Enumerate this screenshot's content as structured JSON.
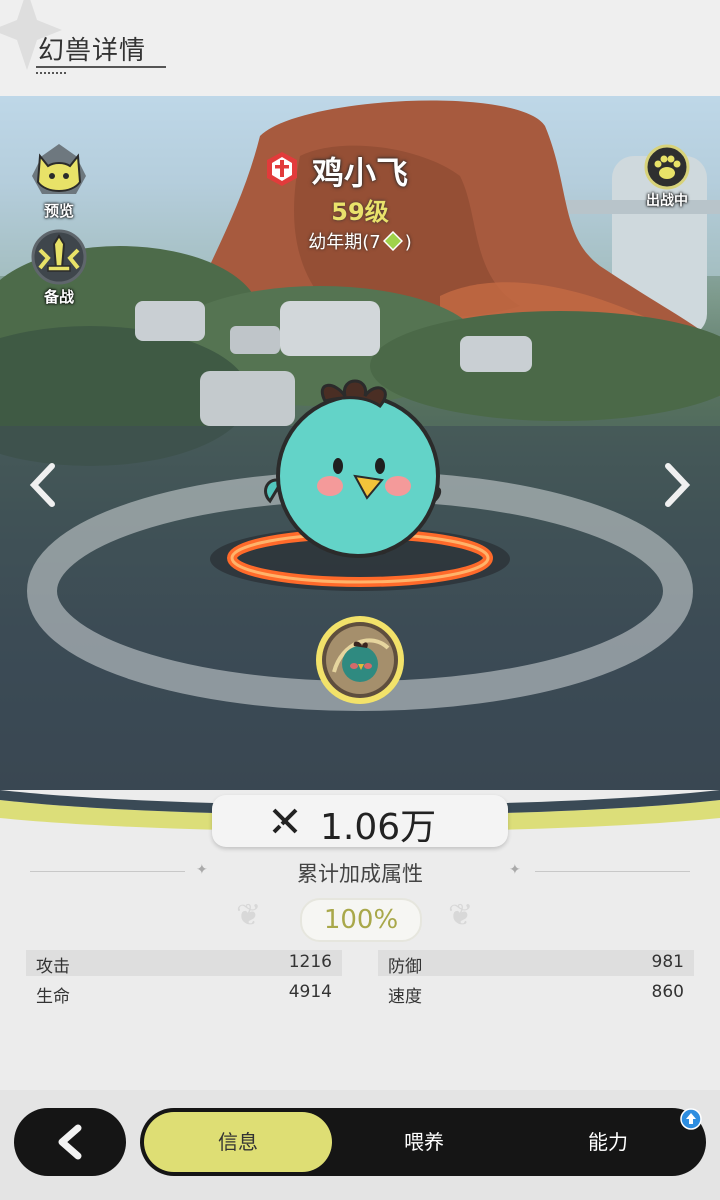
{
  "header": {
    "title": "幻兽详情"
  },
  "side_buttons": {
    "preview": "预览",
    "prepare": "备战",
    "deployed": "出战中"
  },
  "pet": {
    "name": "鸡小飞",
    "level": "59级",
    "stage_prefix": "幼年期(7",
    "stage_suffix": ")"
  },
  "power": {
    "value": "1.06万"
  },
  "bonus": {
    "label": "累计加成属性",
    "value": "100%"
  },
  "stats": [
    {
      "name": "攻击",
      "value": "1216"
    },
    {
      "name": "防御",
      "value": "981"
    },
    {
      "name": "生命",
      "value": "4914"
    },
    {
      "name": "速度",
      "value": "860"
    }
  ],
  "tabs": {
    "info": "信息",
    "feed": "喂养",
    "ability": "能力"
  },
  "colors": {
    "accent": "#dede74",
    "nav_dark": "#151515",
    "level_yellow": "#e9e26b",
    "ring_orange": "#ff6a2a"
  },
  "icons": {
    "preview": "cat-icon",
    "prepare": "sword-shield-icon",
    "deployed": "paw-icon",
    "element": "sword-emblem-icon",
    "power": "crossed-swords-icon",
    "back": "chevron-left-icon"
  }
}
